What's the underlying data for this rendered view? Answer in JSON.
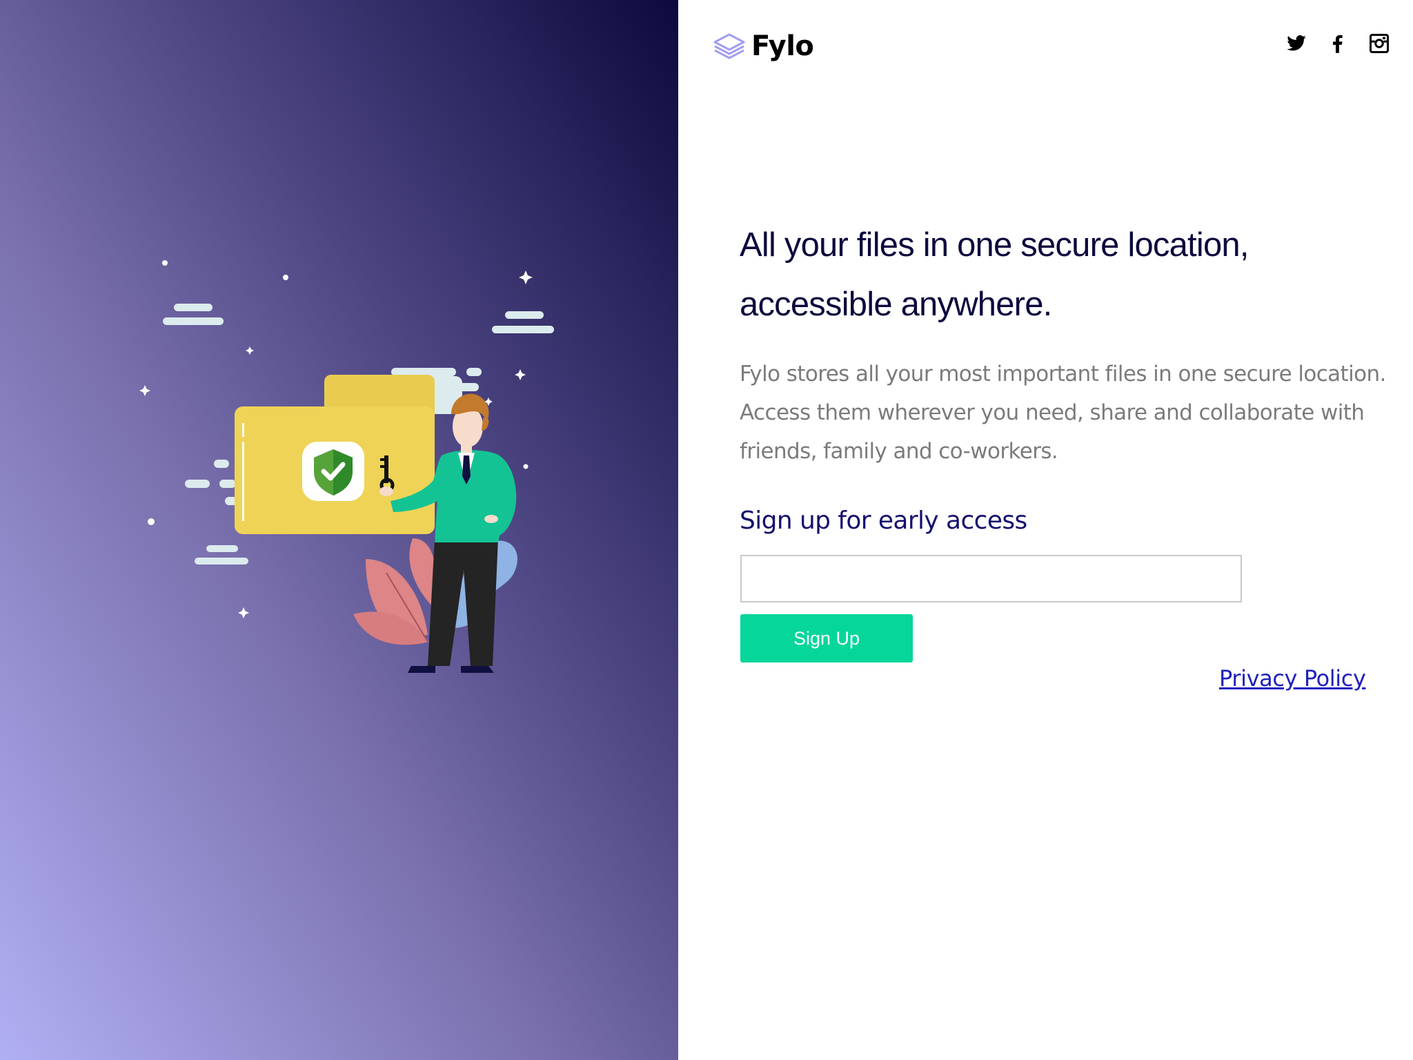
{
  "brand": {
    "name": "Fylo",
    "icon": "layers-icon",
    "icon_color": "#a29ef0"
  },
  "social": [
    {
      "name": "twitter",
      "icon": "twitter-icon"
    },
    {
      "name": "facebook",
      "icon": "facebook-icon"
    },
    {
      "name": "instagram",
      "icon": "instagram-icon"
    }
  ],
  "hero": {
    "illustration": "man-holding-key-at-secure-folder",
    "headline": "All your files in one secure location, accessible anywhere.",
    "description": "Fylo stores all your most important files in one secure location. Access them wherever you need, share and collaborate with friends, family and co-workers."
  },
  "signup": {
    "heading": "Sign up for early access",
    "email_value": "",
    "button_label": "Sign Up"
  },
  "footer": {
    "privacy_label": "Privacy Policy"
  },
  "colors": {
    "gradient_light": "#b1aff3",
    "gradient_dark": "#0c0a3e",
    "headline": "#0c0a3e",
    "heading": "#14106e",
    "button": "#07d69a",
    "body_text": "#7b7b7b",
    "link": "#2020c0"
  }
}
